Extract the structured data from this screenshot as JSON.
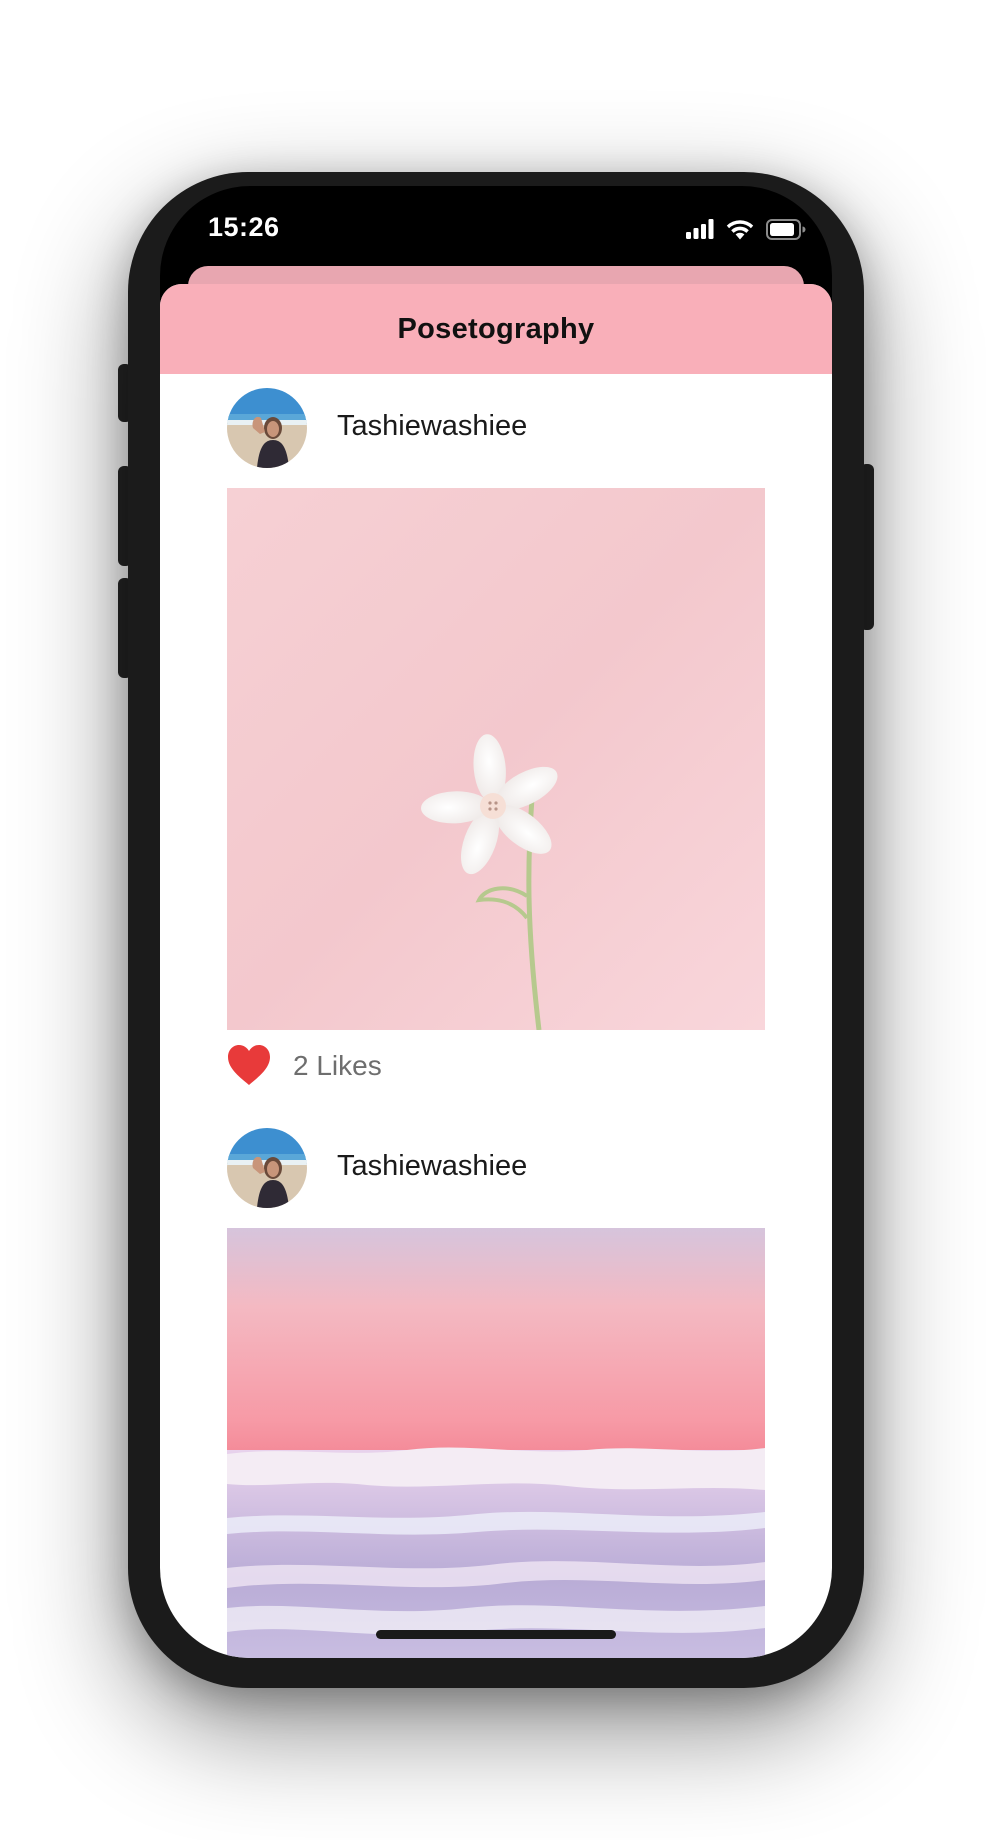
{
  "status_bar": {
    "time": "15:26",
    "icons": [
      "cellular-signal-icon",
      "wifi-icon",
      "battery-icon"
    ]
  },
  "nav": {
    "title": "Posetography"
  },
  "posts": [
    {
      "username": "Tashiewashiee",
      "avatar": "user-avatar",
      "image": "white-flower-on-pink-photo",
      "likes_label": "2 Likes",
      "like_icon": "heart-icon"
    },
    {
      "username": "Tashiewashiee",
      "avatar": "user-avatar",
      "image": "pink-sunset-ocean-waves-photo"
    }
  ],
  "colors": {
    "nav_background": "#f9afb9",
    "back_sheet": "#e8a6b0",
    "heart": "#e83a3a",
    "likes_text": "#6e6e6e",
    "phone_frame": "#1b1b1b"
  }
}
